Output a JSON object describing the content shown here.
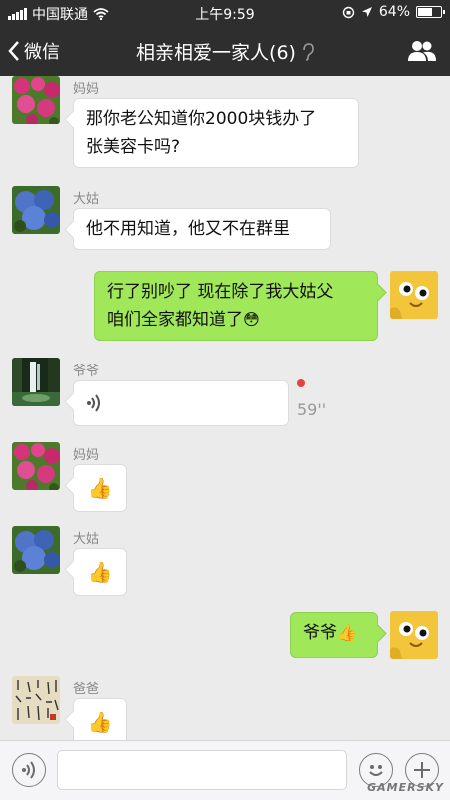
{
  "status": {
    "carrier": "中国联通",
    "time": "上午9:59",
    "battery": "64%",
    "battery_level": 0.64
  },
  "nav": {
    "back_label": "微信",
    "title": "相亲相爱一家人(6)"
  },
  "messages": [
    {
      "sender": "妈妈",
      "text_line1": "那你老公知道你2000块钱办了",
      "text_line2": "张美容卡吗?"
    },
    {
      "sender": "大姑",
      "text": "他不用知道，他又不在群里"
    },
    {
      "text_line1": "行了别吵了 现在除了我大姑父",
      "text_line2": "咱们全家都知道了",
      "emoji": "😳"
    },
    {
      "sender": "爷爷",
      "duration": "59''"
    },
    {
      "sender": "妈妈",
      "emoji": "👍"
    },
    {
      "sender": "大姑",
      "emoji": "👍"
    },
    {
      "text": "爷爷",
      "emoji": "👍"
    },
    {
      "sender": "爸爸",
      "emoji": "👍"
    }
  ],
  "input": {
    "placeholder": "",
    "watermark": "GAMERSKY"
  },
  "colors": {
    "bar": "#2e2e2e",
    "chat_bg": "#ebebeb",
    "my_bubble": "#a0e75a",
    "unread": "#e64340"
  }
}
